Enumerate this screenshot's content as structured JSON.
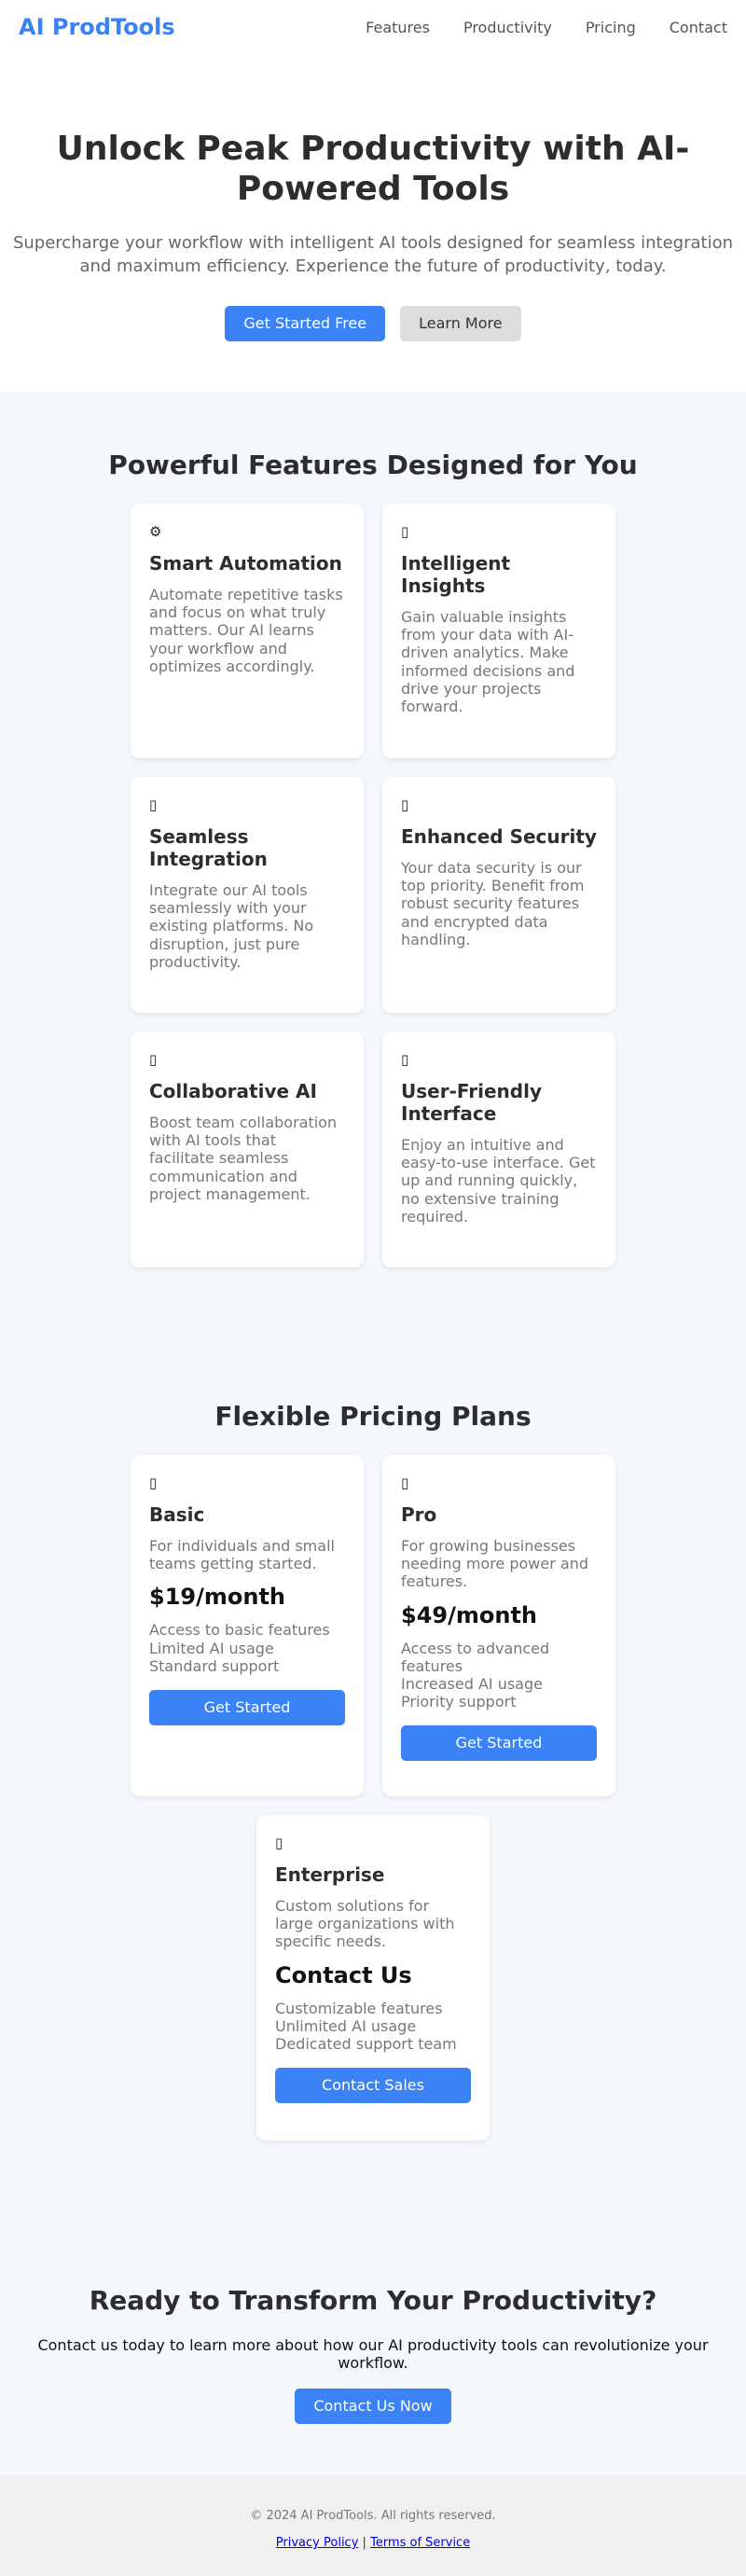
{
  "header": {
    "logo": "AI ProdTools",
    "nav": [
      "Features",
      "Productivity",
      "Pricing",
      "Contact"
    ]
  },
  "hero": {
    "title": "Unlock Peak Productivity with AI-Powered Tools",
    "subtitle": "Supercharge your workflow with intelligent AI tools designed for seamless integration and maximum efficiency. Experience the future of productivity, today.",
    "primary_button": "Get Started Free",
    "secondary_button": "Learn More"
  },
  "features": {
    "title": "Powerful Features Designed for You",
    "items": [
      {
        "icon": "⚙",
        "icon_name": "gear-icon",
        "title": "Smart Automation",
        "text": "Automate repetitive tasks and focus on what truly matters. Our AI learns your workflow and optimizes accordingly."
      },
      {
        "icon": "▯",
        "icon_name": "insights-icon",
        "title": "Intelligent Insights",
        "text": "Gain valuable insights from your data with AI-driven analytics. Make informed decisions and drive your projects forward."
      },
      {
        "icon": "▯",
        "icon_name": "integration-icon",
        "title": "Seamless Integration",
        "text": "Integrate our AI tools seamlessly with your existing platforms. No disruption, just pure productivity."
      },
      {
        "icon": "▯",
        "icon_name": "security-icon",
        "title": "Enhanced Security",
        "text": "Your data security is our top priority. Benefit from robust security features and encrypted data handling."
      },
      {
        "icon": "▯",
        "icon_name": "collaboration-icon",
        "title": "Collaborative AI",
        "text": "Boost team collaboration with AI tools that facilitate seamless communication and project management."
      },
      {
        "icon": "▯",
        "icon_name": "interface-icon",
        "title": "User-Friendly Interface",
        "text": "Enjoy an intuitive and easy-to-use interface. Get up and running quickly, no extensive training required."
      }
    ]
  },
  "pricing": {
    "title": "Flexible Pricing Plans",
    "plans": [
      {
        "icon": "▯",
        "icon_name": "basic-plan-icon",
        "name": "Basic",
        "desc": "For individuals and small teams getting started.",
        "price": "$19/month",
        "features": [
          "Access to basic features",
          "Limited AI usage",
          "Standard support"
        ],
        "button": "Get Started"
      },
      {
        "icon": "▯",
        "icon_name": "pro-plan-icon",
        "name": "Pro",
        "desc": "For growing businesses needing more power and features.",
        "price": "$49/month",
        "features": [
          "Access to advanced features",
          "Increased AI usage",
          "Priority support"
        ],
        "button": "Get Started"
      },
      {
        "icon": "▯",
        "icon_name": "enterprise-plan-icon",
        "name": "Enterprise",
        "desc": "Custom solutions for large organizations with specific needs.",
        "price": "Contact Us",
        "features": [
          "Customizable features",
          "Unlimited AI usage",
          "Dedicated support team"
        ],
        "button": "Contact Sales"
      }
    ]
  },
  "cta": {
    "title": "Ready to Transform Your Productivity?",
    "text": "Contact us today to learn more about how our AI productivity tools can revolutionize your workflow.",
    "button": "Contact Us Now"
  },
  "footer": {
    "copyright": "© 2024 AI ProdTools. All rights reserved.",
    "privacy": "Privacy Policy",
    "separator": "|",
    "terms": "Terms of Service"
  },
  "colors": {
    "accent": "#3b82f6",
    "section_bg": "#f4f7fc",
    "footer_bg": "#f0f0f0"
  }
}
